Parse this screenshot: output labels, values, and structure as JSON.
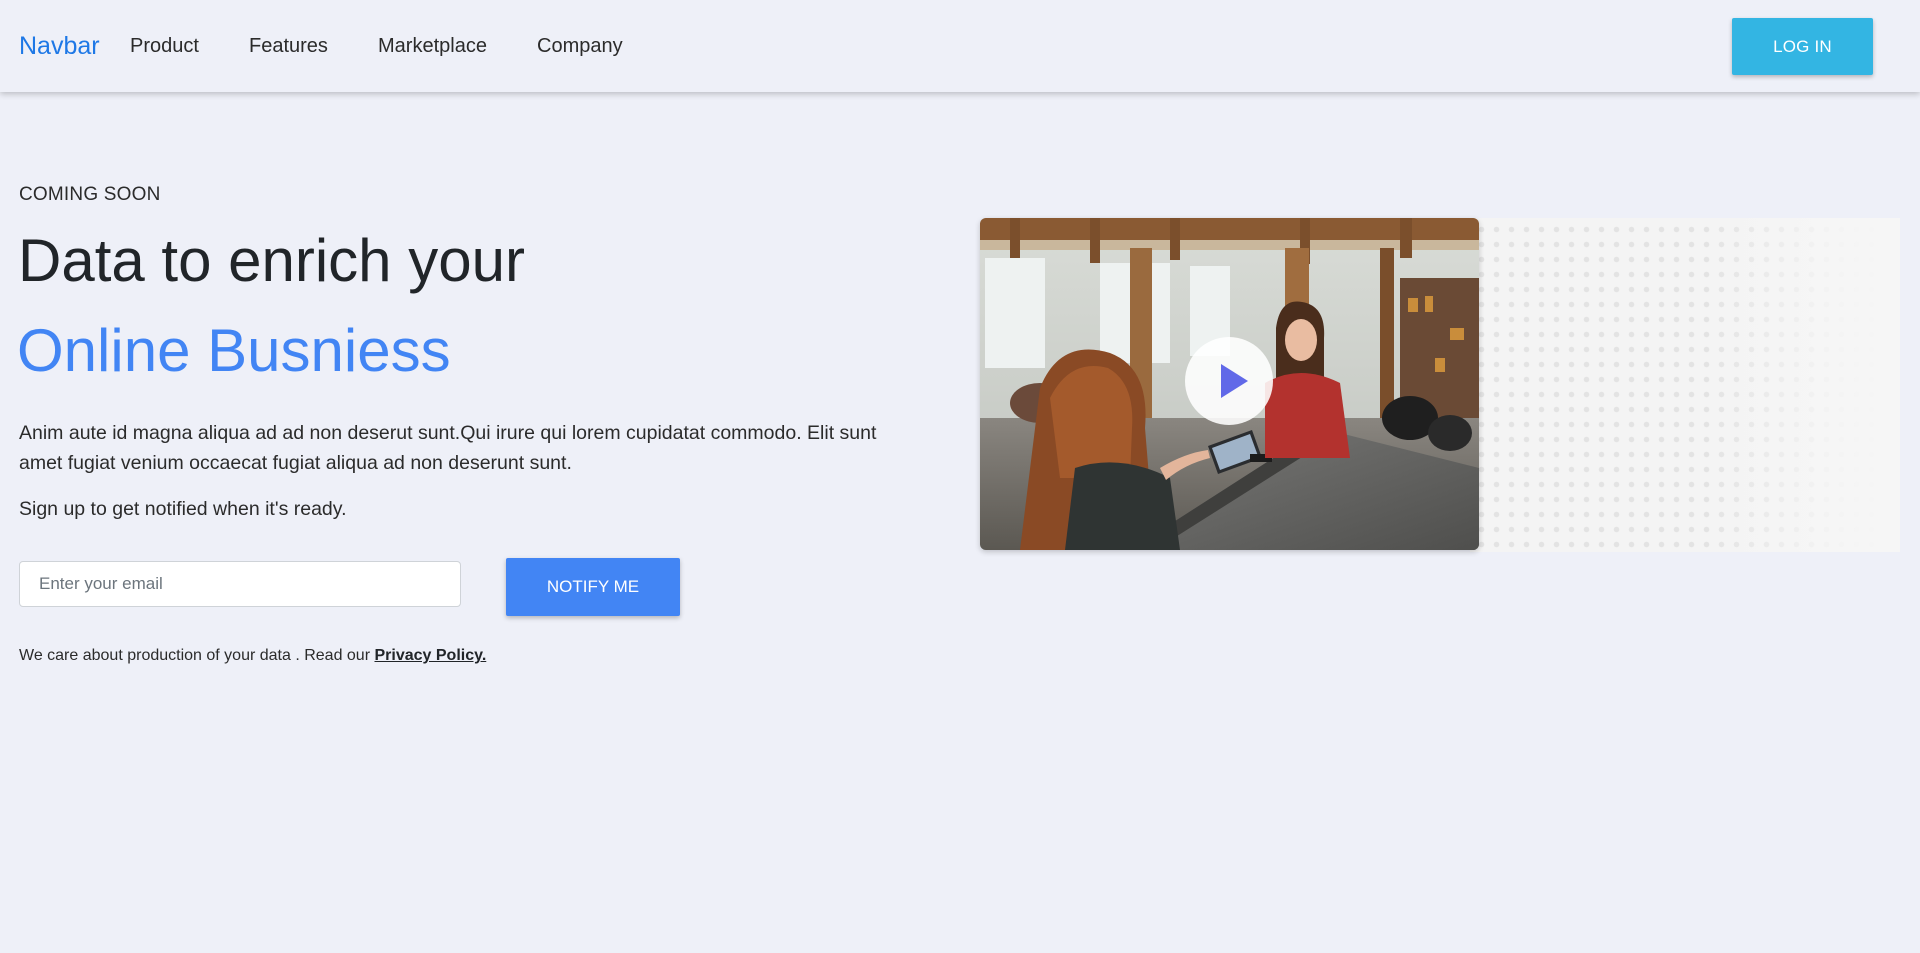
{
  "navbar": {
    "brand": "Navbar",
    "links": [
      "Product",
      "Features",
      "Marketplace",
      "Company"
    ],
    "login_label": "LOG IN"
  },
  "hero": {
    "eyebrow": "COMING SOON",
    "headline_line1": "Data to enrich your",
    "headline_line2": "Online Busniess",
    "lead": "Anim aute id magna aliqua ad ad non deserut sunt.Qui irure qui lorem cupidatat commodo. Elit sunt amet fugiat venium occaecat fugiat aliqua ad non deserunt sunt.",
    "signup_note": "Sign up to get notified when it's ready.",
    "email_placeholder": "Enter your email",
    "notify_label": "NOTIFY ME",
    "privacy_text": "We care about production of your data . Read our ",
    "privacy_link": "Privacy Policy."
  },
  "media": {
    "play_icon": "play-icon",
    "image_subject": "two women at a shop counter with a point-of-sale tablet"
  },
  "colors": {
    "background": "#eef0f8",
    "brand": "#1e78e6",
    "accent_blue": "#4285f4",
    "login_button": "#33b5e3",
    "play_triangle": "#6169e8"
  }
}
